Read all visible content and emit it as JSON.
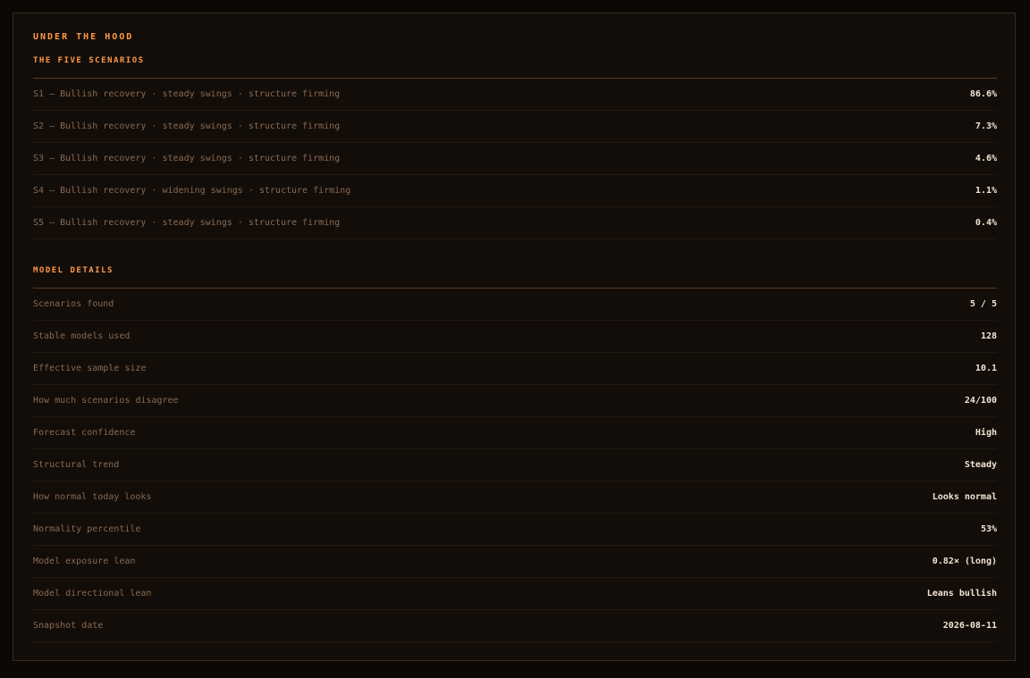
{
  "panel": {
    "title": "UNDER THE HOOD"
  },
  "scenarios": {
    "heading": "THE FIVE SCENARIOS",
    "rows": [
      {
        "label": "S1 — Bullish recovery · steady swings · structure firming",
        "value": "86.6%"
      },
      {
        "label": "S2 — Bullish recovery · steady swings · structure firming",
        "value": "7.3%"
      },
      {
        "label": "S3 — Bullish recovery · steady swings · structure firming",
        "value": "4.6%"
      },
      {
        "label": "S4 — Bullish recovery · widening swings · structure firming",
        "value": "1.1%"
      },
      {
        "label": "S5 — Bullish recovery · steady swings · structure firming",
        "value": "0.4%"
      }
    ]
  },
  "model": {
    "heading": "MODEL DETAILS",
    "rows": [
      {
        "label": "Scenarios found",
        "value": "5 / 5"
      },
      {
        "label": "Stable models used",
        "value": "128"
      },
      {
        "label": "Effective sample size",
        "value": "10.1"
      },
      {
        "label": "How much scenarios disagree",
        "value": "24/100"
      },
      {
        "label": "Forecast confidence",
        "value": "High"
      },
      {
        "label": "Structural trend",
        "value": "Steady"
      },
      {
        "label": "How normal today looks",
        "value": "Looks normal"
      },
      {
        "label": "Normality percentile",
        "value": "53%"
      },
      {
        "label": "Model exposure lean",
        "value": "0.82× (long)"
      },
      {
        "label": "Model directional lean",
        "value": "Leans bullish"
      },
      {
        "label": "Snapshot date",
        "value": "2026-08-11"
      }
    ]
  },
  "colors": {
    "accent": "#ff9a4a",
    "label": "#8a6a52",
    "value": "#f2e4d4",
    "background": "#120d09"
  }
}
